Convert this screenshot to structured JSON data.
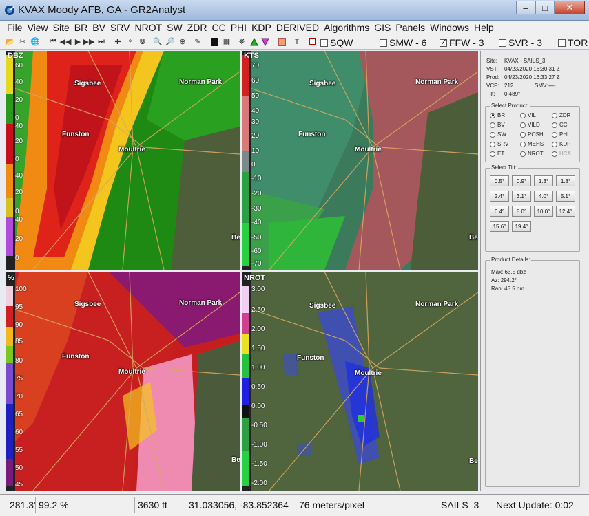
{
  "window": {
    "title": "KVAX Moody AFB, GA - GR2Analyst"
  },
  "menu": [
    "File",
    "View",
    "Site",
    "BR",
    "BV",
    "SRV",
    "NROT",
    "SW",
    "ZDR",
    "CC",
    "PHI",
    "KDP",
    "DERIVED",
    "Algorithms",
    "GIS",
    "Panels",
    "Windows",
    "Help"
  ],
  "toolbar": {
    "icons": [
      "open-icon",
      "cut-icon",
      "globe-icon",
      "first-frame-icon",
      "prev-frame-icon",
      "play-icon",
      "next-frame-icon",
      "last-frame-icon",
      "pan-icon",
      "crosshair-icon",
      "probe-icon",
      "zoom-in-icon",
      "zoom-out-icon",
      "zoom-reset-icon",
      "pen-icon",
      "black-square-icon",
      "grid-icon",
      "spiral-icon",
      "green-triangle-icon",
      "magenta-triangle-icon",
      "orange-square-icon",
      "text-icon",
      "placefile-icon"
    ],
    "checks": {
      "sqw": {
        "label": "SQW",
        "checked": false
      },
      "smw": {
        "label": "SMW - 6",
        "checked": false
      },
      "ffw": {
        "label": "FFW - 3",
        "checked": true
      },
      "svr": {
        "label": "SVR - 3",
        "checked": false
      },
      "tor": {
        "label": "TOR",
        "checked": false
      }
    }
  },
  "panels": {
    "br": {
      "label": "DBZ",
      "scale": [
        "60",
        "40",
        "20",
        "0",
        "40",
        "20",
        "0",
        "40",
        "20",
        "0",
        "40",
        "20",
        "0"
      ]
    },
    "bv": {
      "label": "KTS",
      "scale": [
        "70",
        "60",
        "50",
        "40",
        "30",
        "20",
        "10",
        "0",
        "-10",
        "-20",
        "-30",
        "-40",
        "-50",
        "-60",
        "-70"
      ]
    },
    "cc": {
      "label": "%",
      "scale": [
        "100",
        "95",
        "90",
        "85",
        "80",
        "75",
        "70",
        "65",
        "60",
        "55",
        "50",
        "45"
      ]
    },
    "nrot": {
      "label": "NROT",
      "scale": [
        "3.00",
        "2.50",
        "2.00",
        "1.50",
        "1.00",
        "0.50",
        "0.00",
        "-0.50",
        "-1.00",
        "-1.50",
        "-2.00"
      ]
    },
    "cities": {
      "sigsbee": "Sigsbee",
      "norman_park": "Norman Park",
      "funston": "Funston",
      "moultrie": "Moultrie",
      "be": "Be"
    }
  },
  "side": {
    "site_label": "Site:",
    "site": "KVAX - SAILS_3",
    "vst_label": "VST:",
    "vst": "04/23/2020  16:30:31 Z",
    "prod_label": "Prod:",
    "prod": "04/23/2020  16:33:27 Z",
    "vcp_label": "VCP:",
    "vcp": "212",
    "smv_label": "SMV:",
    "smv": "----",
    "tilt_label": "Tilt:",
    "tilt": "0.489°",
    "select_product": "Select Product:",
    "products": [
      {
        "label": "BR",
        "selected": true,
        "enabled": true
      },
      {
        "label": "VIL",
        "selected": false,
        "enabled": true
      },
      {
        "label": "ZDR",
        "selected": false,
        "enabled": true
      },
      {
        "label": "BV",
        "selected": false,
        "enabled": true
      },
      {
        "label": "VILD",
        "selected": false,
        "enabled": true
      },
      {
        "label": "CC",
        "selected": false,
        "enabled": true
      },
      {
        "label": "SW",
        "selected": false,
        "enabled": true
      },
      {
        "label": "POSH",
        "selected": false,
        "enabled": true
      },
      {
        "label": "PHI",
        "selected": false,
        "enabled": true
      },
      {
        "label": "SRV",
        "selected": false,
        "enabled": true
      },
      {
        "label": "MEHS",
        "selected": false,
        "enabled": true
      },
      {
        "label": "KDP",
        "selected": false,
        "enabled": true
      },
      {
        "label": "ET",
        "selected": false,
        "enabled": true
      },
      {
        "label": "NROT",
        "selected": false,
        "enabled": true
      },
      {
        "label": "HCA",
        "selected": false,
        "enabled": false
      }
    ],
    "select_tilt": "Select Tilt:",
    "tilts": [
      "0.5°",
      "0.9°",
      "1.3°",
      "1.8°",
      "2.4°",
      "3.1°",
      "4.0°",
      "5.1°",
      "6.4°",
      "8.0°",
      "10.0°",
      "12.4°",
      "15.6°",
      "19.4°"
    ],
    "product_details": "Product Details:",
    "max": "Max:  63.5 dbz",
    "az": "Az:   294.2°",
    "ran": "Ran:  45.5 nm"
  },
  "status": {
    "azimuth": "281.3°",
    "percent": "99.2 %",
    "height": "3630 ft",
    "coords": "31.033056, -83.852364",
    "resolution": "76 meters/pixel",
    "mode": "SAILS_3",
    "next_update": "Next Update: 0:02"
  }
}
